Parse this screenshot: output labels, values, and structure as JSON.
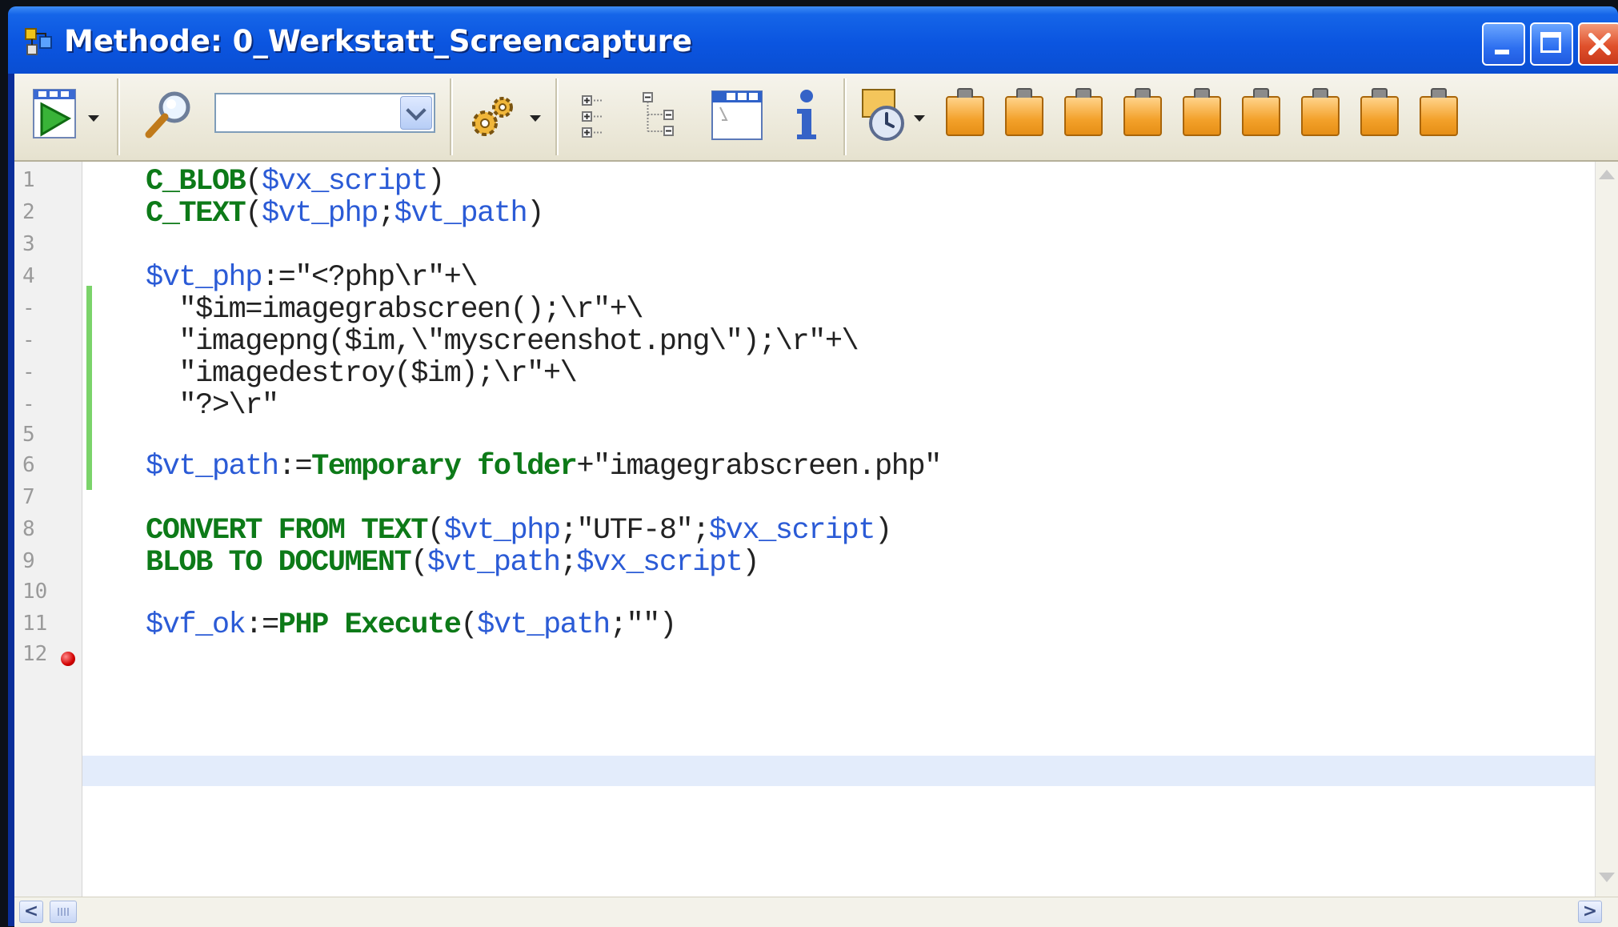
{
  "window": {
    "title": "Methode: 0_Werkstatt_Screencapture"
  },
  "toolbar": {
    "search_value": "",
    "icons": [
      "run-icon",
      "search-icon",
      "settings-icon",
      "collapse-icon",
      "tree-icon",
      "form-icon",
      "info-icon",
      "timer-icon",
      "clipboard-icon"
    ],
    "clipboard_count": 9
  },
  "editor": {
    "line_numbers": [
      "1",
      "2",
      "3",
      "4",
      "-",
      "-",
      "-",
      "-",
      "5",
      "6",
      "7",
      "8",
      "9",
      "10",
      "11",
      "12"
    ],
    "lines": [
      [
        {
          "t": "k",
          "x": "C_BLOB"
        },
        {
          "t": "s",
          "x": "("
        },
        {
          "t": "v",
          "x": "$vx_script"
        },
        {
          "t": "s",
          "x": ")"
        }
      ],
      [
        {
          "t": "k",
          "x": "C_TEXT"
        },
        {
          "t": "s",
          "x": "("
        },
        {
          "t": "v",
          "x": "$vt_php"
        },
        {
          "t": "s",
          "x": ";"
        },
        {
          "t": "v",
          "x": "$vt_path"
        },
        {
          "t": "s",
          "x": ")"
        }
      ],
      [],
      [
        {
          "t": "v",
          "x": "$vt_php"
        },
        {
          "t": "s",
          "x": ":=\"<?php\\r\"+\\"
        }
      ],
      [
        {
          "t": "s",
          "x": "  \"$im=imagegrabscreen();\\r\"+\\"
        }
      ],
      [
        {
          "t": "s",
          "x": "  \"imagepng($im,\\\"myscreenshot.png\\\");\\r\"+\\"
        }
      ],
      [
        {
          "t": "s",
          "x": "  \"imagedestroy($im);\\r\"+\\"
        }
      ],
      [
        {
          "t": "s",
          "x": "  \"?>\\r\""
        }
      ],
      [],
      [
        {
          "t": "v",
          "x": "$vt_path"
        },
        {
          "t": "s",
          "x": ":="
        },
        {
          "t": "k",
          "x": "Temporary folder"
        },
        {
          "t": "s",
          "x": "+\"imagegrabscreen.php\""
        }
      ],
      [],
      [
        {
          "t": "k",
          "x": "CONVERT FROM TEXT"
        },
        {
          "t": "s",
          "x": "("
        },
        {
          "t": "v",
          "x": "$vt_php"
        },
        {
          "t": "s",
          "x": ";\"UTF-8\";"
        },
        {
          "t": "v",
          "x": "$vx_script"
        },
        {
          "t": "s",
          "x": ")"
        }
      ],
      [
        {
          "t": "k",
          "x": "BLOB TO DOCUMENT"
        },
        {
          "t": "s",
          "x": "("
        },
        {
          "t": "v",
          "x": "$vt_path"
        },
        {
          "t": "s",
          "x": ";"
        },
        {
          "t": "v",
          "x": "$vx_script"
        },
        {
          "t": "s",
          "x": ")"
        }
      ],
      [],
      [
        {
          "t": "v",
          "x": "$vf_ok"
        },
        {
          "t": "s",
          "x": ":="
        },
        {
          "t": "k",
          "x": "PHP Execute"
        },
        {
          "t": "s",
          "x": "("
        },
        {
          "t": "v",
          "x": "$vt_path"
        },
        {
          "t": "s",
          "x": ";\"\")"
        }
      ],
      []
    ],
    "breakpoint_line": "11",
    "current_line": "12"
  },
  "colors": {
    "keyword": "#0d7a18",
    "variable": "#2b5bd6",
    "text": "#222222",
    "titlebar": "#0b55e0"
  }
}
